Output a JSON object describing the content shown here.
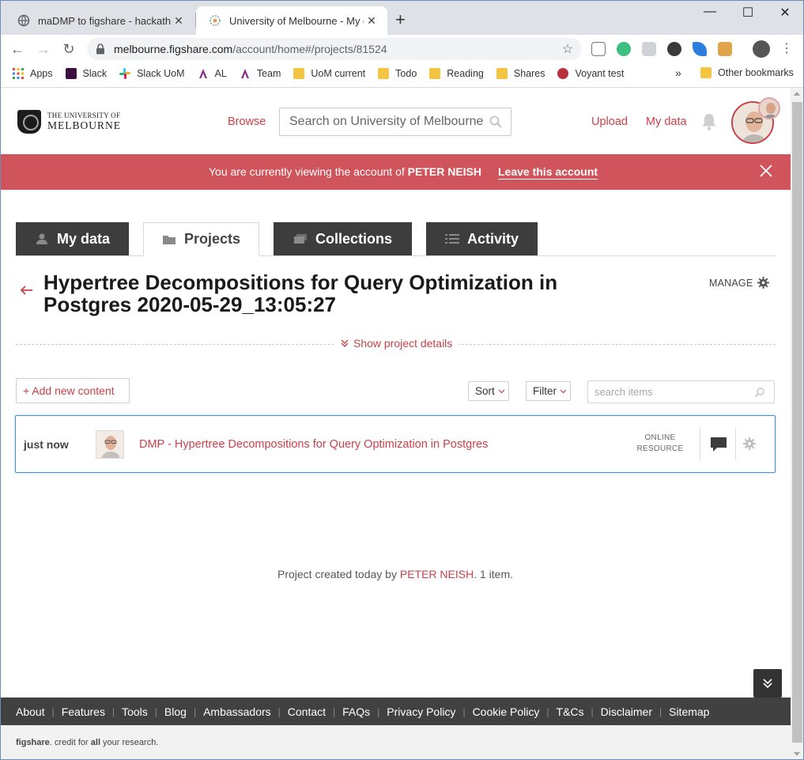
{
  "browser": {
    "tabs": [
      {
        "title": "maDMP to figshare - hackathon",
        "close": "✕"
      },
      {
        "title": "University of Melbourne - My data",
        "close": "✕"
      }
    ],
    "new_tab": "+",
    "window_controls": {
      "minimize": "—",
      "maximize": "☐",
      "close": "✕"
    },
    "url_host": "melbourne.figshare.com",
    "url_path": "/account/home#/projects/81524",
    "bookmarks": [
      {
        "label": "Apps",
        "icon": "apps-grid-icon"
      },
      {
        "label": "Slack",
        "icon": "slack-icon"
      },
      {
        "label": "Slack UoM",
        "icon": "slack-icon"
      },
      {
        "label": "AL",
        "icon": "al-icon"
      },
      {
        "label": "Team",
        "icon": "team-icon"
      },
      {
        "label": "UoM current",
        "icon": "folder-icon"
      },
      {
        "label": "Todo",
        "icon": "folder-icon"
      },
      {
        "label": "Reading",
        "icon": "folder-icon"
      },
      {
        "label": "Shares",
        "icon": "folder-icon"
      },
      {
        "label": "Voyant test",
        "icon": "voyant-icon"
      }
    ],
    "bookmarks_overflow": "»",
    "other_bookmarks": "Other bookmarks"
  },
  "site": {
    "logo_small": "THE UNIVERSITY OF",
    "logo_big": "MELBOURNE",
    "browse": "Browse",
    "search_placeholder": "Search on University of Melbourne",
    "upload": "Upload",
    "my_data": "My data"
  },
  "banner": {
    "prefix": "You are currently viewing the account of",
    "user": "PETER NEISH",
    "leave": "Leave this account"
  },
  "tabs": {
    "my_data": "My data",
    "projects": "Projects",
    "collections": "Collections",
    "activity": "Activity"
  },
  "project": {
    "title": "Hypertree Decompositions for Query Optimization in Postgres 2020-05-29_13:05:27",
    "manage": "MANAGE",
    "show_details": "Show project details",
    "add_content": "+ Add new content",
    "sort": "Sort",
    "filter": "Filter",
    "search_placeholder": "search items"
  },
  "items": [
    {
      "when": "just now",
      "title": "DMP - Hypertree Decompositions for Query Optimization in Postgres",
      "type_line1": "ONLINE",
      "type_line2": "RESOURCE"
    }
  ],
  "created": {
    "prefix": "Project created today by",
    "user": "PETER NEISH",
    "suffix": ". 1 item."
  },
  "footer": {
    "links": [
      "About",
      "Features",
      "Tools",
      "Blog",
      "Ambassadors",
      "Contact",
      "FAQs",
      "Privacy Policy",
      "Cookie Policy",
      "T&Cs",
      "Disclaimer",
      "Sitemap"
    ],
    "brand": "figshare",
    "tagline_mid": ". credit for ",
    "tagline_all": "all",
    "tagline_end": " your research."
  },
  "colors": {
    "accent": "#c8424a",
    "banner": "#d0545b",
    "dark_tab": "#3d3d3d",
    "footer": "#414141",
    "selected_border": "#4a90d9"
  }
}
